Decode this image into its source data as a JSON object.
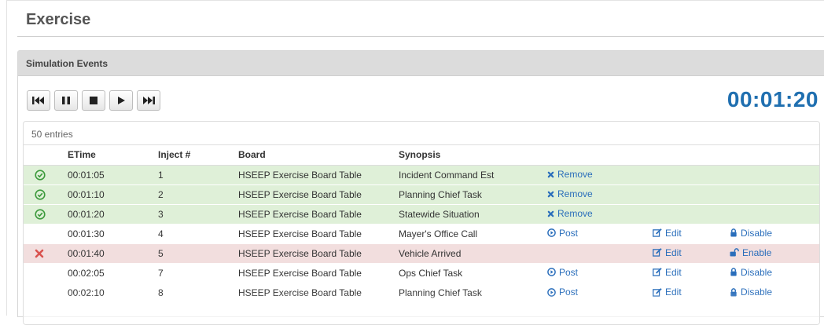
{
  "page": {
    "title": "Exercise"
  },
  "panel": {
    "heading": "Simulation Events"
  },
  "controls": [
    {
      "name": "skip-back-icon"
    },
    {
      "name": "pause-icon"
    },
    {
      "name": "stop-icon"
    },
    {
      "name": "play-icon"
    },
    {
      "name": "skip-forward-icon"
    }
  ],
  "timer": "00:01:20",
  "table": {
    "entries_label": "50 entries",
    "headers": [
      "ETime",
      "Inject #",
      "Board",
      "Synopsis"
    ],
    "rows": [
      {
        "state": "done",
        "status_icon": "check-circle-icon",
        "etime": "00:01:05",
        "inject": "1",
        "board": "HSEEP Exercise Board Table",
        "synopsis": "Incident Command Est",
        "action1": "Remove",
        "action1_icon": "x-icon",
        "action2": "",
        "action3": "",
        "action3_icon": ""
      },
      {
        "state": "done",
        "status_icon": "check-circle-icon",
        "etime": "00:01:10",
        "inject": "2",
        "board": "HSEEP Exercise Board Table",
        "synopsis": "Planning Chief Task",
        "action1": "Remove",
        "action1_icon": "x-icon",
        "action2": "",
        "action3": "",
        "action3_icon": ""
      },
      {
        "state": "done",
        "status_icon": "check-circle-icon",
        "etime": "00:01:20",
        "inject": "3",
        "board": "HSEEP Exercise Board Table",
        "synopsis": "Statewide Situation",
        "action1": "Remove",
        "action1_icon": "x-icon",
        "action2": "",
        "action3": "",
        "action3_icon": ""
      },
      {
        "state": "pending",
        "status_icon": "",
        "etime": "00:01:30",
        "inject": "4",
        "board": "HSEEP Exercise Board Table",
        "synopsis": "Mayer's Office Call",
        "action1": "Post",
        "action1_icon": "post-icon",
        "action2": "Edit",
        "action3": "Disable",
        "action3_icon": "lock-icon"
      },
      {
        "state": "error",
        "status_icon": "x-red-icon",
        "etime": "00:01:40",
        "inject": "5",
        "board": "HSEEP Exercise Board Table",
        "synopsis": "Vehicle Arrived",
        "action1": "",
        "action1_icon": "",
        "action2": "Edit",
        "action3": "Enable",
        "action3_icon": "unlock-icon"
      },
      {
        "state": "pending",
        "status_icon": "",
        "etime": "00:02:05",
        "inject": "7",
        "board": "HSEEP Exercise Board Table",
        "synopsis": "Ops Chief Task",
        "action1": "Post",
        "action1_icon": "post-icon",
        "action2": "Edit",
        "action3": "Disable",
        "action3_icon": "lock-icon"
      },
      {
        "state": "pending",
        "status_icon": "",
        "etime": "00:02:10",
        "inject": "8",
        "board": "HSEEP Exercise Board Table",
        "synopsis": "Planning Chief Task",
        "action1": "Post",
        "action1_icon": "post-icon",
        "action2": "Edit",
        "action3": "Disable",
        "action3_icon": "lock-icon"
      }
    ]
  },
  "colors": {
    "accent": "#2a6ebb",
    "timer": "#1f6fb0",
    "done_row": "#dff0d8",
    "error_row": "#f2dede",
    "check": "#3c9a3c",
    "error_x": "#d9534f"
  }
}
